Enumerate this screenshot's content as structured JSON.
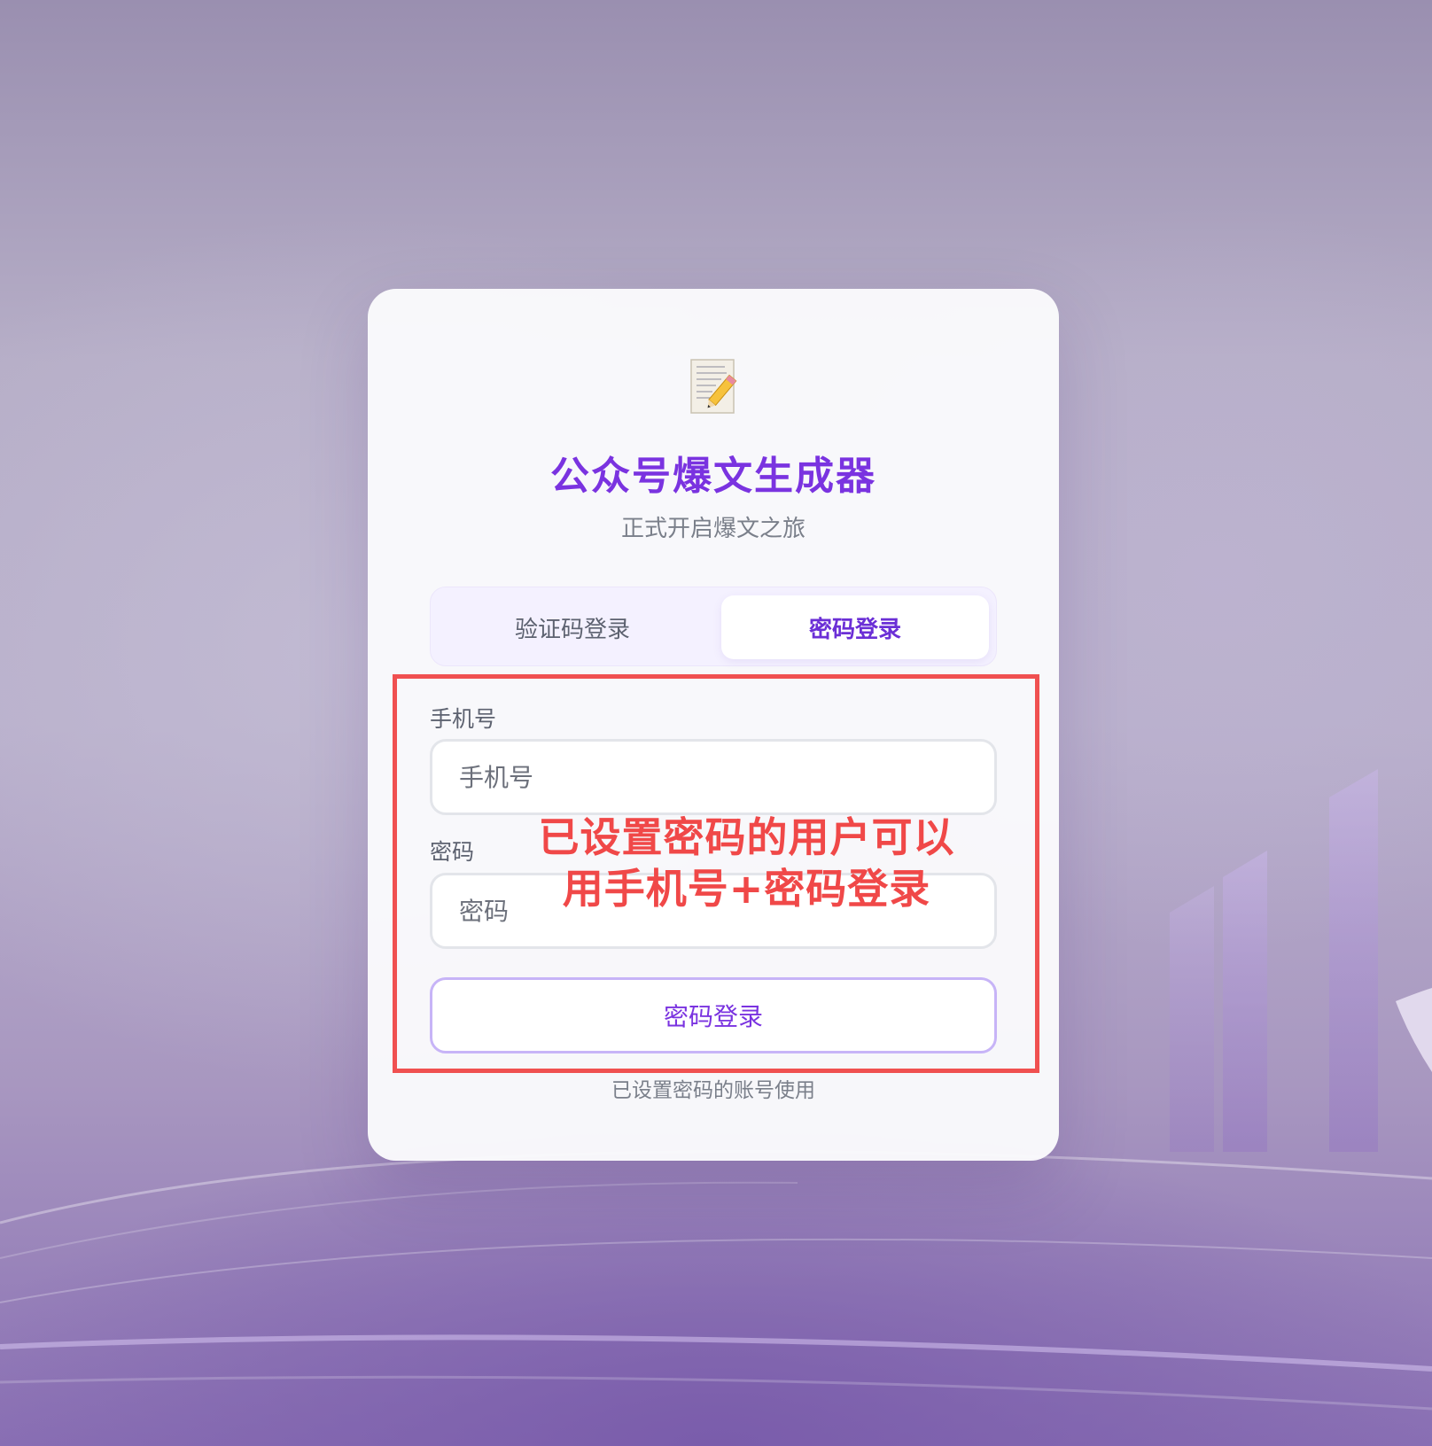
{
  "app": {
    "title": "公众号爆文生成器",
    "subtitle": "正式开启爆文之旅",
    "logo_icon": "memo-pencil-icon"
  },
  "tabs": [
    {
      "label": "验证码登录",
      "active": false
    },
    {
      "label": "密码登录",
      "active": true
    }
  ],
  "form": {
    "phone_label": "手机号",
    "phone_placeholder": "手机号",
    "password_label": "密码",
    "password_placeholder": "密码",
    "submit_label": "密码登录",
    "footnote": "已设置密码的账号使用"
  },
  "annotation": {
    "line1": "已设置密码的用户可以",
    "line2": "用手机号+密码登录",
    "color": "#f04848"
  },
  "colors": {
    "accent": "#7a33e0",
    "background": "#b6aec7"
  }
}
